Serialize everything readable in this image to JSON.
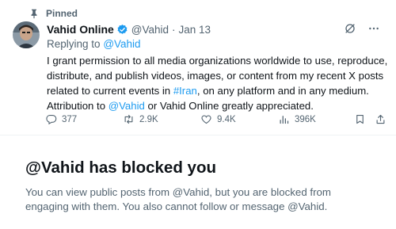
{
  "tweet": {
    "pinned_label": "Pinned",
    "display_name": "Vahid Online",
    "handle": "@Vahid",
    "separator": "·",
    "date": "Jan 13",
    "replying_prefix": "Replying to",
    "replying_mention": "@Vahid",
    "body": {
      "part1": "I grant permission to all media organizations worldwide to use, reproduce, distribute, and publish videos, images, or content from my recent X posts related to current events in ",
      "hashtag": "#Iran",
      "part2": ", on any platform and in any medium. Attribution to ",
      "mention": "@Vahid",
      "part3": " or Vahid Online greatly appreciated."
    },
    "actions": {
      "replies": "377",
      "reposts": "2.9K",
      "likes": "9.4K",
      "views": "396K"
    },
    "icons": [
      "pin-icon",
      "verified-icon",
      "grok-icon",
      "more-icon",
      "reply-icon",
      "repost-icon",
      "like-icon",
      "views-icon",
      "bookmark-icon",
      "share-icon"
    ]
  },
  "blocked": {
    "title": "@Vahid has blocked you",
    "description": "You can view public posts from @Vahid, but you are blocked from engaging with them. You also cannot follow or message @Vahid."
  },
  "colors": {
    "accent": "#1d9bf0",
    "text_primary": "#0f1419",
    "text_secondary": "#536471"
  }
}
